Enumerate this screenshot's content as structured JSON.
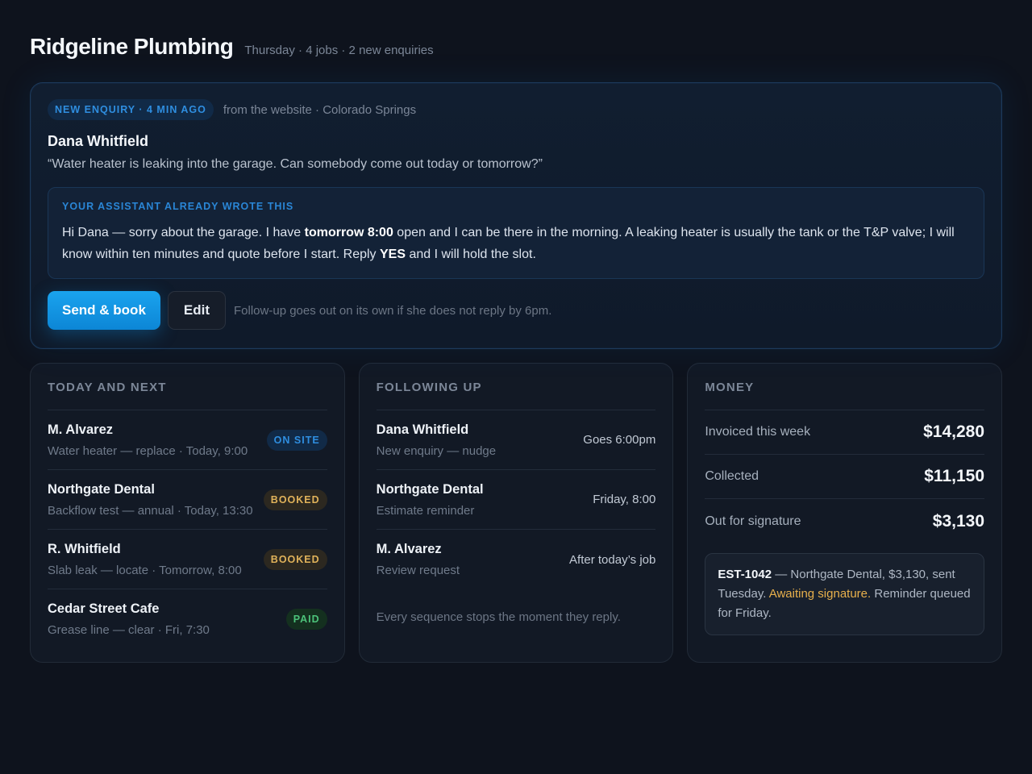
{
  "header": {
    "title": "Ridgeline Plumbing",
    "subtitle": "Thursday · 4 jobs · 2 new enquiries"
  },
  "enquiry": {
    "badge": "NEW ENQUIRY · 4 MIN AGO",
    "source": "from the website · Colorado Springs",
    "name": "Dana Whitfield",
    "quote": "“Water heater is leaking into the garage. Can somebody come out today or tomorrow?”",
    "draft": {
      "label": "YOUR ASSISTANT ALREADY WROTE THIS",
      "text_1": "Hi Dana — sorry about the garage. I have ",
      "bold_1": "tomorrow 8:00",
      "text_2": " open and I can be there in the morning. A leaking heater is usually the tank or the T&P valve; I will know within ten minutes and quote before I start. Reply ",
      "bold_2": "YES",
      "text_3": " and I will hold the slot."
    },
    "primary_button": "Send & book",
    "secondary_button": "Edit",
    "note": "Follow-up goes out on its own if she does not reply by 6pm."
  },
  "today": {
    "title": "TODAY AND NEXT",
    "items": [
      {
        "name": "M. Alvarez",
        "detail": "Water heater — replace · Today, 9:00",
        "status": "ON SITE"
      },
      {
        "name": "Northgate Dental",
        "detail": "Backflow test — annual · Today, 13:30",
        "status": "BOOKED"
      },
      {
        "name": "R. Whitfield",
        "detail": "Slab leak — locate · Tomorrow, 8:00",
        "status": "BOOKED"
      },
      {
        "name": "Cedar Street Cafe",
        "detail": "Grease line — clear · Fri, 7:30",
        "status": "PAID"
      }
    ]
  },
  "following": {
    "title": "FOLLOWING UP",
    "items": [
      {
        "name": "Dana Whitfield",
        "detail": "New enquiry — nudge",
        "when": "Goes 6:00pm"
      },
      {
        "name": "Northgate Dental",
        "detail": "Estimate reminder",
        "when": "Friday, 8:00"
      },
      {
        "name": "M. Alvarez",
        "detail": "Review request",
        "when": "After today’s job"
      }
    ],
    "note": "Every sequence stops the moment they reply."
  },
  "money": {
    "title": "MONEY",
    "rows": [
      {
        "label": "Invoiced this week",
        "value": "$14,280"
      },
      {
        "label": "Collected",
        "value": "$11,150"
      },
      {
        "label": "Out for signature",
        "value": "$3,130"
      }
    ],
    "estimate": {
      "id": "EST-1042",
      "text_1": " — Northgate Dental, $3,130, sent Tuesday. ",
      "highlight": "Awaiting signature.",
      "text_2": " Reminder queued for Friday."
    }
  },
  "colors": {
    "accent": "#0e8fde",
    "status_onsite": "#2f8ee0",
    "status_booked": "#e0b25a",
    "status_paid": "#4cc27a",
    "warning": "#e8b04c"
  }
}
